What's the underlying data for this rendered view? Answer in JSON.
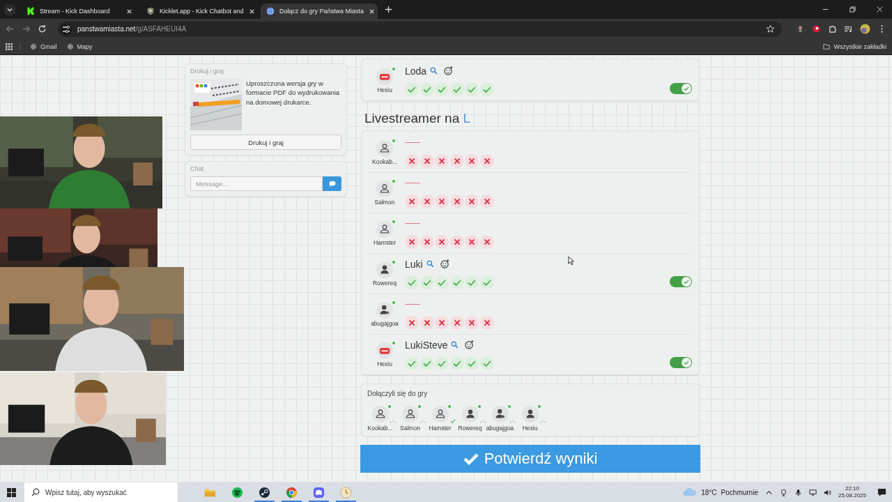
{
  "browser": {
    "tabs": [
      {
        "title": "Stream - Kick Dashboard",
        "selected": false
      },
      {
        "title": "Kicklet.app - Kick Chatbot and ",
        "selected": false
      },
      {
        "title": "Dołącz do gry Państwa Miasta",
        "selected": true
      }
    ],
    "url_host": "panstwamiasta.net",
    "url_path": "/g/ASFAHEUI4A",
    "bookmarks": [
      "Gmail",
      "Mapy"
    ],
    "all_bookmarks": "Wszystkie zakładki"
  },
  "print_card": {
    "title": "Drukuj i graj",
    "text": "Uproszczona wersja gry w formacie PDF do wydrukowania na domowej drukarce.",
    "button": "Drukuj i graj"
  },
  "chat": {
    "title": "Chat",
    "placeholder": "Message..."
  },
  "previous_answers": [
    {
      "player": "Hexiu",
      "kind": "stop",
      "answer": "Loda",
      "accepted": true,
      "votes": [
        true,
        true,
        true,
        true,
        true,
        true
      ]
    }
  ],
  "category": {
    "title": "Livestreamer na",
    "letter": "L"
  },
  "answers": [
    {
      "player": "Kookab...",
      "kind": "user",
      "accepted": false,
      "votes": [
        false,
        false,
        false,
        false,
        false,
        false
      ]
    },
    {
      "player": "Salmon",
      "kind": "user",
      "accepted": false,
      "votes": [
        false,
        false,
        false,
        false,
        false,
        false
      ]
    },
    {
      "player": "Hamster",
      "kind": "user",
      "accepted": false,
      "votes": [
        false,
        false,
        false,
        false,
        false,
        false
      ]
    },
    {
      "player": "Rowereq",
      "kind": "user-filled",
      "answer": "Luki",
      "accepted": true,
      "votes": [
        true,
        true,
        true,
        true,
        true,
        true
      ]
    },
    {
      "player": "abugajgoa",
      "kind": "user-star",
      "accepted": false,
      "votes": [
        false,
        false,
        false,
        false,
        false,
        false
      ]
    },
    {
      "player": "Hexiu",
      "kind": "stop",
      "answer": "LukiSteve",
      "accepted": true,
      "votes": [
        true,
        true,
        true,
        true,
        true,
        true
      ]
    }
  ],
  "joined": {
    "title": "Dołączyli się do gry",
    "players": [
      {
        "name": "Kookab...",
        "kind": "user",
        "ready": false
      },
      {
        "name": "Salmon",
        "kind": "user",
        "ready": false
      },
      {
        "name": "Hamster",
        "kind": "user",
        "ready": true
      },
      {
        "name": "Rowereq",
        "kind": "user-filled",
        "ready": false
      },
      {
        "name": "abugajgoa",
        "kind": "user-star",
        "ready": false
      },
      {
        "name": "Hexiu",
        "kind": "user-filled",
        "ready": false
      }
    ]
  },
  "confirm_button": "Potwierdź wyniki",
  "taskbar": {
    "search_placeholder": "Wpisz tutaj, aby wyszukać",
    "temperature": "18°C",
    "weather": "Pochmurnie",
    "time": "22:10",
    "date": "25.08.2025"
  }
}
